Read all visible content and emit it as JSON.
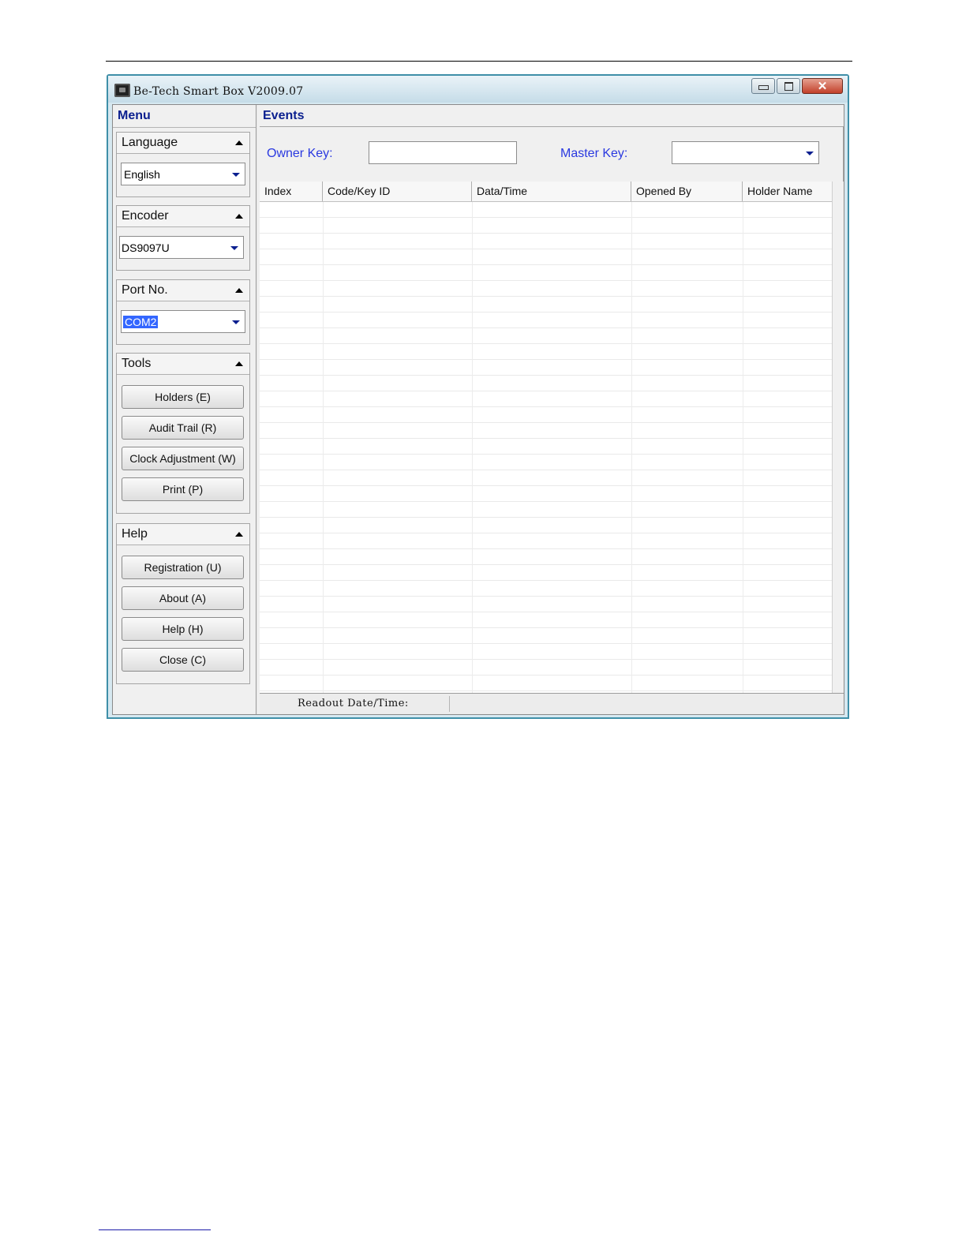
{
  "window": {
    "title": "Be-Tech Smart Box V2009.07"
  },
  "menu": {
    "title": "Menu",
    "language": {
      "label": "Language",
      "value": "English"
    },
    "encoder": {
      "label": "Encoder",
      "value": "DS9097U"
    },
    "port": {
      "label": "Port No.",
      "value": "COM2"
    },
    "tools": {
      "label": "Tools",
      "holders": "Holders (E)",
      "audit_trail": "Audit Trail (R)",
      "clock_adjustment": "Clock Adjustment (W)",
      "print": "Print (P)"
    },
    "help": {
      "label": "Help",
      "registration": "Registration (U)",
      "about": "About (A)",
      "help": "Help (H)",
      "close": "Close (C)"
    }
  },
  "events": {
    "title": "Events",
    "owner_key_label": "Owner Key:",
    "owner_key_value": "",
    "master_key_label": "Master Key:",
    "master_key_value": "",
    "columns": [
      "Index",
      "Code/Key ID",
      "Data/Time",
      "Opened By",
      "Holder Name"
    ]
  },
  "status": {
    "readout_label": "Readout Date/Time:"
  }
}
